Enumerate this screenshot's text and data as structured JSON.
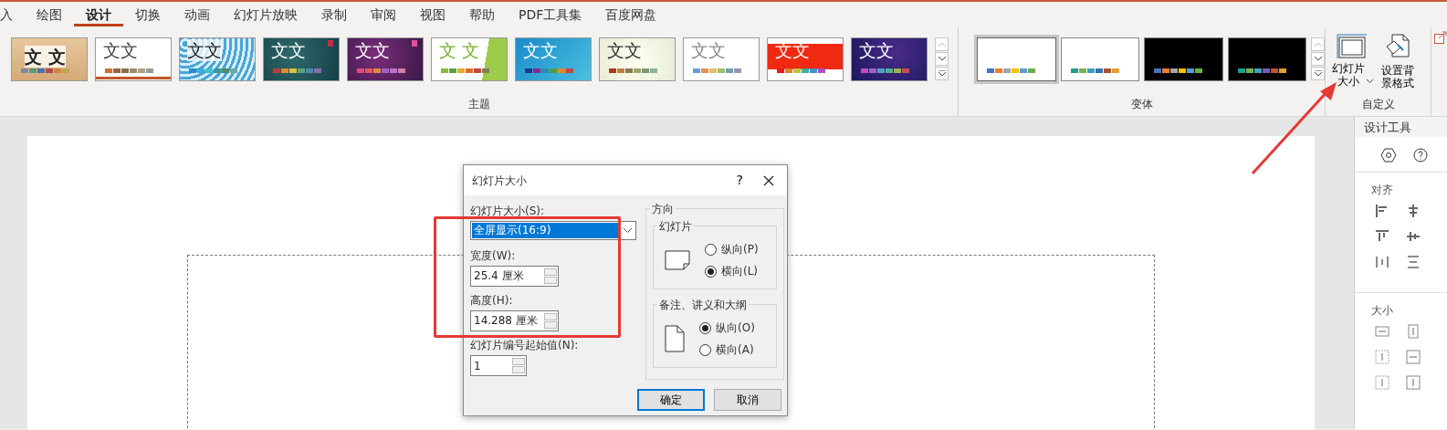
{
  "ribbon_tabs": [
    {
      "label": "入",
      "selected": false
    },
    {
      "label": "绘图",
      "selected": false
    },
    {
      "label": "设计",
      "selected": true
    },
    {
      "label": "切换",
      "selected": false
    },
    {
      "label": "动画",
      "selected": false
    },
    {
      "label": "幻灯片放映",
      "selected": false
    },
    {
      "label": "录制",
      "selected": false
    },
    {
      "label": "审阅",
      "selected": false
    },
    {
      "label": "视图",
      "selected": false
    },
    {
      "label": "帮助",
      "selected": false
    },
    {
      "label": "PDF工具集",
      "selected": false
    },
    {
      "label": "百度网盘",
      "selected": false
    }
  ],
  "themes_group": {
    "label": "主题",
    "themes": [
      {
        "text": "文 文"
      },
      {
        "text": "文文"
      },
      {
        "text": "文文"
      },
      {
        "text": "文文"
      },
      {
        "text": "文文"
      },
      {
        "text": "文 文"
      },
      {
        "text": "文文"
      },
      {
        "text": "文文"
      },
      {
        "text": "文文"
      },
      {
        "text": "文文"
      },
      {
        "text": "文文"
      }
    ]
  },
  "variants_group": {
    "label": "变体",
    "variants": [
      {
        "selected": true
      },
      {
        "selected": false
      },
      {
        "selected": false
      },
      {
        "selected": false
      }
    ]
  },
  "customize_group": {
    "label": "自定义",
    "buttons": [
      {
        "label": "幻灯片大小",
        "kind": "size"
      },
      {
        "label": "设置背景格式",
        "kind": "background"
      }
    ]
  },
  "dialog": {
    "title": "幻灯片大小",
    "help": "?",
    "size_label": "幻灯片大小(S):",
    "size_value": "全屏显示(16:9)",
    "width_label": "宽度(W):",
    "width_value": "25.4 厘米",
    "height_label": "高度(H):",
    "height_value": "14.288 厘米",
    "start_label": "幻灯片编号起始值(N):",
    "start_value": "1",
    "orientation": {
      "title": "方向",
      "groups": [
        {
          "title": "幻灯片",
          "kind": "landscape",
          "options": [
            {
              "label": "纵向(P)",
              "selected": false
            },
            {
              "label": "横向(L)",
              "selected": true
            }
          ]
        },
        {
          "title": "备注、讲义和大纲",
          "kind": "portrait",
          "options": [
            {
              "label": "纵向(O)",
              "selected": true
            },
            {
              "label": "横向(A)",
              "selected": false
            }
          ]
        }
      ]
    },
    "buttons": [
      {
        "label": "确定",
        "default": true
      },
      {
        "label": "取消",
        "default": false
      }
    ]
  },
  "design_pane": {
    "title": "设计工具",
    "sections": [
      {
        "title": "对齐",
        "kind": "align"
      },
      {
        "title": "大小",
        "kind": "size"
      }
    ]
  }
}
